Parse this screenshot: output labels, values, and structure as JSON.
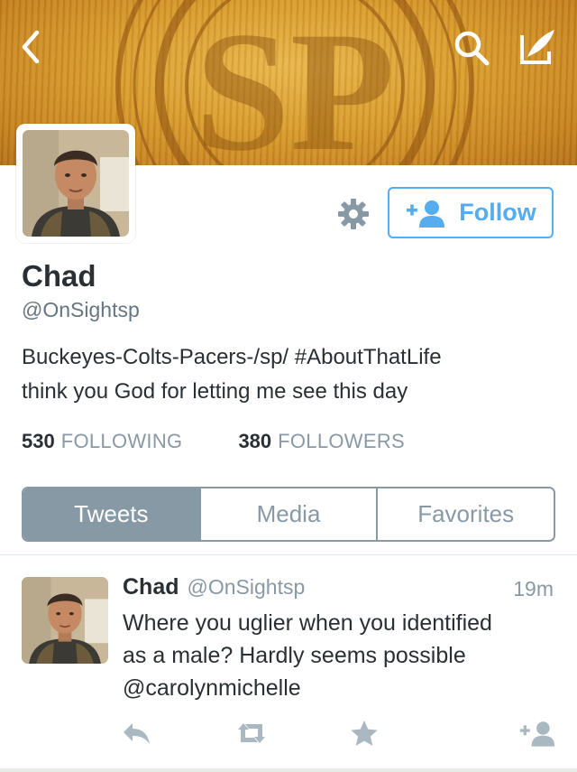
{
  "header": {
    "back_icon": "chevron-left-icon",
    "search_icon": "search-icon",
    "compose_icon": "compose-quill-icon",
    "banner_monogram": "SP"
  },
  "profile": {
    "name": "Chad",
    "handle": "@OnSightsp",
    "bio_lines": [
      "Buckeyes-Colts-Pacers-/sp/ #AboutThatLife",
      "think you God for letting me see this day"
    ],
    "following_count": "530",
    "following_label": "FOLLOWING",
    "followers_count": "380",
    "followers_label": "FOLLOWERS",
    "settings_icon": "gear-icon",
    "follow_label": "Follow",
    "follow_icon": "add-user-icon"
  },
  "tabs": [
    {
      "label": "Tweets",
      "active": true
    },
    {
      "label": "Media",
      "active": false
    },
    {
      "label": "Favorites",
      "active": false
    }
  ],
  "tweet": {
    "name": "Chad",
    "handle": "@OnSightsp",
    "time": "19m",
    "text_lines": [
      "Where you uglier when you identified",
      "as a male? Hardly seems possible",
      "@carolynmichelle"
    ],
    "actions": [
      "reply-icon",
      "retweet-icon",
      "favorite-star-icon",
      "follow-add-user-icon"
    ]
  },
  "colors": {
    "accent": "#55acee",
    "tab_active": "#8899a6",
    "muted_text": "#8899a6",
    "body_text": "#292f33"
  }
}
